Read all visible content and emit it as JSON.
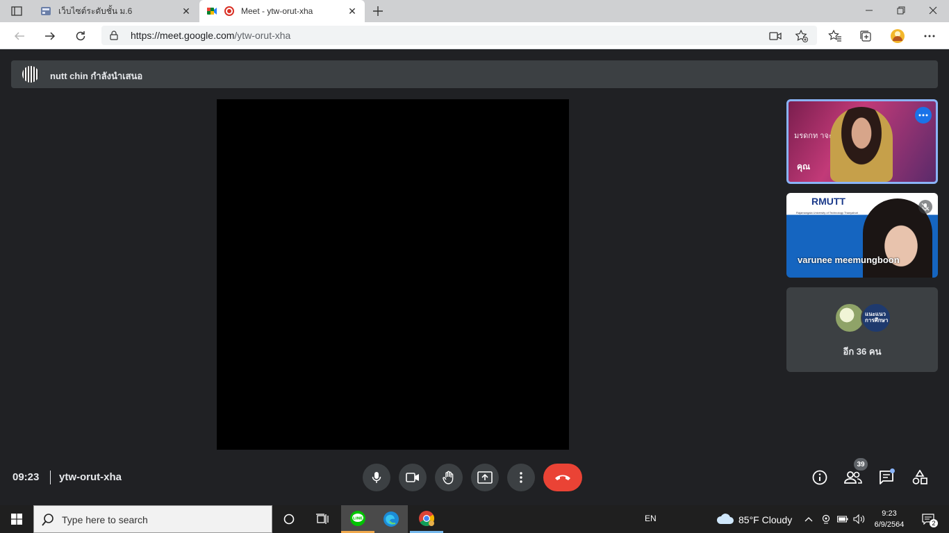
{
  "browser": {
    "tabs": [
      {
        "title": "เว็บไซต์ระดับชั้น ม.6",
        "active": false
      },
      {
        "title": "Meet - ytw-orut-xha",
        "active": true
      }
    ],
    "url": {
      "domain": "https://meet.google.com",
      "path": "/ytw-orut-xha"
    }
  },
  "meet": {
    "presenting_text": "nutt chin กำลังนำเสนอ",
    "self_tile": {
      "name": "คุณ",
      "slide_text": "มรดกท        าจะเบจ"
    },
    "participant_tile": {
      "name": "varunee meemungboon",
      "logo": "RMUTT",
      "logo_sub": "Rajamangala University of Technology Thanyaburi"
    },
    "others_tile": {
      "avatar_text": "แนะแนว การศึกษา",
      "more_label": "อีก 36 คน"
    },
    "clock": "09:23",
    "meeting_code": "ytw-orut-xha",
    "participant_count": "39",
    "colors": {
      "end_call": "#ea4335",
      "highlight": "#8ab4f8",
      "accent": "#1a73e8"
    }
  },
  "taskbar": {
    "search_placeholder": "Type here to search",
    "language": "EN",
    "weather": "85°F  Cloudy",
    "time": "9:23",
    "date": "6/9/2564",
    "notification_count": "2"
  }
}
